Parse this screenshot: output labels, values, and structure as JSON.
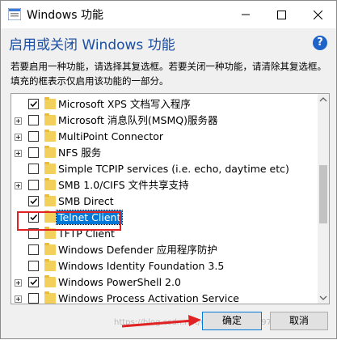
{
  "window": {
    "title": "Windows 功能",
    "minimize_icon": "minimize-icon",
    "maximize_icon": "maximize-icon",
    "close_icon": "close-icon"
  },
  "header": {
    "title": "启用或关闭 Windows 功能",
    "help": "?"
  },
  "description": "若要启用一种功能，请选择其复选框。若要关闭一种功能，请清除其复选框。填充的框表示仅启用该功能的一部分。",
  "features": [
    {
      "label": "Microsoft XPS 文档写入程序",
      "state": "checked",
      "expandable": false
    },
    {
      "label": "Microsoft 消息队列(MSMQ)服务器",
      "state": "unchecked",
      "expandable": true
    },
    {
      "label": "MultiPoint Connector",
      "state": "unchecked",
      "expandable": true
    },
    {
      "label": "NFS 服务",
      "state": "unchecked",
      "expandable": true
    },
    {
      "label": "Simple TCPIP services (i.e. echo, daytime etc)",
      "state": "unchecked",
      "expandable": false
    },
    {
      "label": "SMB 1.0/CIFS 文件共享支持",
      "state": "unchecked",
      "expandable": true
    },
    {
      "label": "SMB Direct",
      "state": "checked",
      "expandable": false
    },
    {
      "label": "Telnet Client",
      "state": "checked",
      "expandable": false,
      "selected": true
    },
    {
      "label": "TFTP Client",
      "state": "unchecked",
      "expandable": false
    },
    {
      "label": "Windows Defender 应用程序防护",
      "state": "unchecked",
      "expandable": false
    },
    {
      "label": "Windows Identity Foundation 3.5",
      "state": "unchecked",
      "expandable": false
    },
    {
      "label": "Windows PowerShell 2.0",
      "state": "checked",
      "expandable": true
    },
    {
      "label": "Windows Process Activation Service",
      "state": "unchecked",
      "expandable": true
    }
  ],
  "buttons": {
    "ok": "确定",
    "cancel": "取消"
  },
  "watermark": "https://blog.csdn.net/weixin_39237797",
  "colors": {
    "accent": "#0078d7",
    "header_text": "#1b4fa3",
    "annotation_red": "#e02222",
    "folder": "#f3cf5b"
  }
}
